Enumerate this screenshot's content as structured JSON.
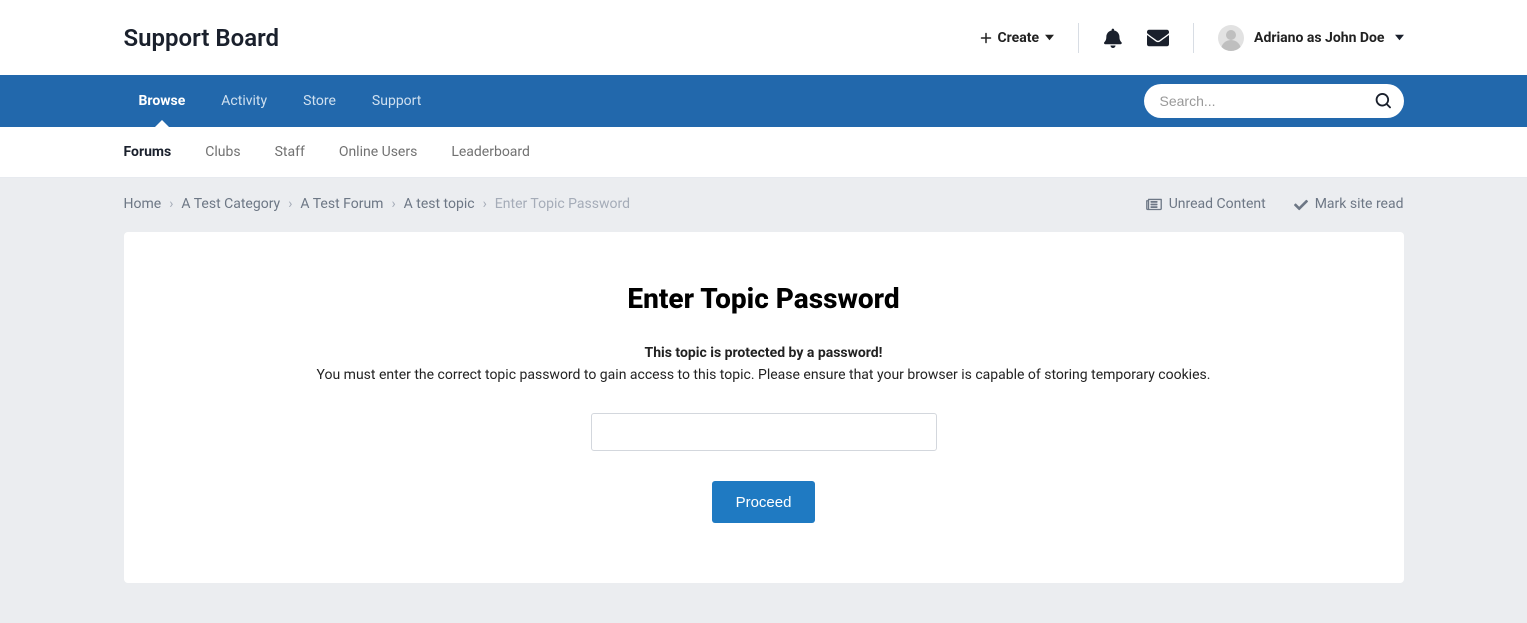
{
  "header": {
    "site_title": "Support Board",
    "create_label": "Create",
    "user_label": "Adriano as John Doe"
  },
  "primary_nav": {
    "items": [
      {
        "label": "Browse",
        "active": true
      },
      {
        "label": "Activity",
        "active": false
      },
      {
        "label": "Store",
        "active": false
      },
      {
        "label": "Support",
        "active": false
      }
    ],
    "search_placeholder": "Search..."
  },
  "sub_nav": {
    "items": [
      {
        "label": "Forums",
        "active": true
      },
      {
        "label": "Clubs",
        "active": false
      },
      {
        "label": "Staff",
        "active": false
      },
      {
        "label": "Online Users",
        "active": false
      },
      {
        "label": "Leaderboard",
        "active": false
      }
    ]
  },
  "breadcrumbs": {
    "items": [
      "Home",
      "A Test Category",
      "A Test Forum",
      "A test topic"
    ],
    "current": "Enter Topic Password",
    "right_links": {
      "unread": "Unread Content",
      "mark_read": "Mark site read"
    }
  },
  "card": {
    "title": "Enter Topic Password",
    "subtitle": "This topic is protected by a password!",
    "description": "You must enter the correct topic password to gain access to this topic. Please ensure that your browser is capable of storing temporary cookies.",
    "proceed_label": "Proceed",
    "password_value": ""
  }
}
